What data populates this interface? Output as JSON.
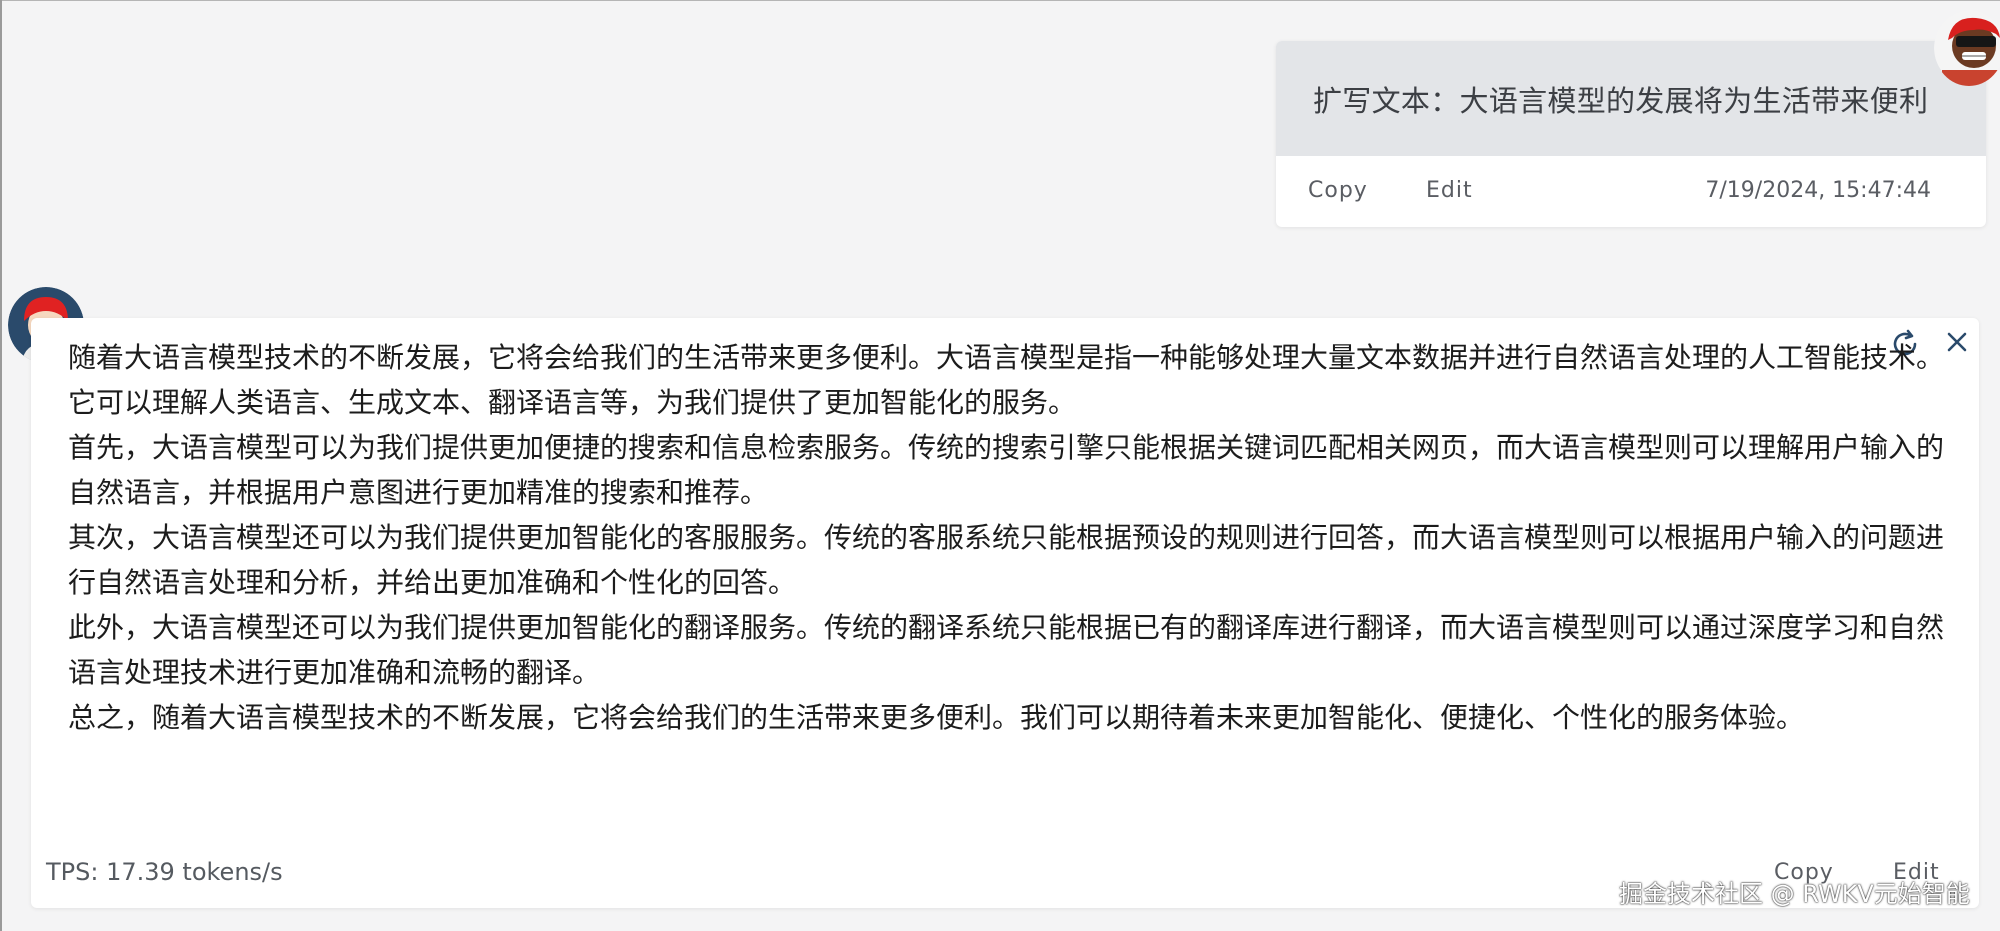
{
  "user_message": {
    "text": "扩写文本：大语言模型的发展将为生活带来便利",
    "copy_label": "Copy",
    "edit_label": "Edit",
    "timestamp": "7/19/2024, 15:47:44"
  },
  "assistant_message": {
    "paragraphs": [
      "随着大语言模型技术的不断发展，它将会给我们的生活带来更多便利。大语言模型是指一种能够处理大量文本数据并进行自然语言处理的人工智能技术。它可以理解人类语言、生成文本、翻译语言等，为我们提供了更加智能化的服务。",
      "首先，大语言模型可以为我们提供更加便捷的搜索和信息检索服务。传统的搜索引擎只能根据关键词匹配相关网页，而大语言模型则可以理解用户输入的自然语言，并根据用户意图进行更加精准的搜索和推荐。",
      "其次，大语言模型还可以为我们提供更加智能化的客服服务。传统的客服系统只能根据预设的规则进行回答，而大语言模型则可以根据用户输入的问题进行自然语言处理和分析，并给出更加准确和个性化的回答。",
      "此外，大语言模型还可以为我们提供更加智能化的翻译服务。传统的翻译系统只能根据已有的翻译库进行翻译，而大语言模型则可以通过深度学习和自然语言处理技术进行更加准确和流畅的翻译。",
      "总之，随着大语言模型技术的不断发展，它将会给我们的生活带来更多便利。我们可以期待着未来更加智能化、便捷化、个性化的服务体验。"
    ],
    "tps": "TPS: 17.39 tokens/s",
    "copy_label": "Copy",
    "edit_label": "Edit"
  },
  "watermark": "掘金技术社区 @ RWKV元始智能",
  "icons": {
    "regenerate": "refresh-icon",
    "close": "close-icon"
  },
  "colors": {
    "background": "#f4f4f5",
    "user_bubble": "#e3e5e8",
    "card": "#ffffff",
    "accent_icon": "#2a4a6b"
  }
}
